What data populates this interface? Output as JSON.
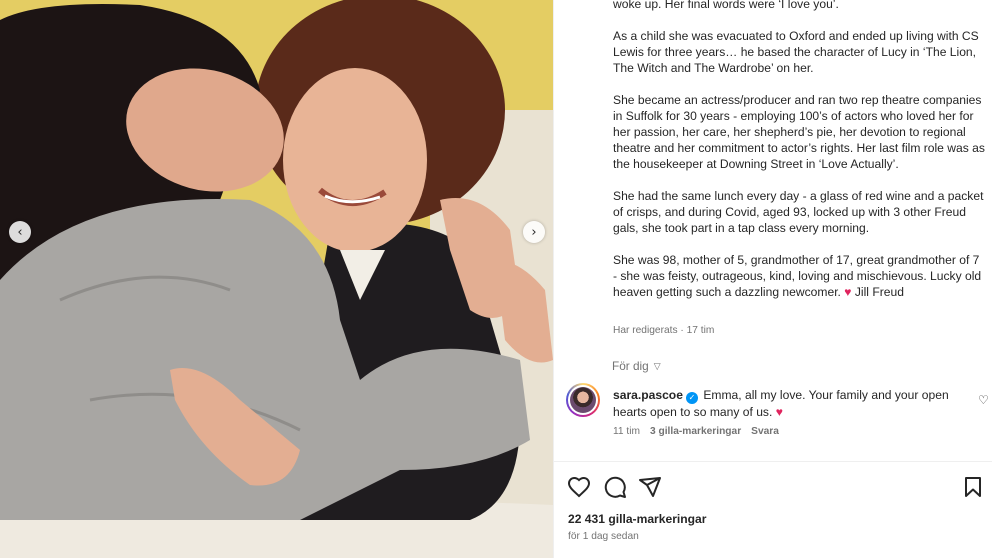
{
  "post": {
    "caption_paragraphs": [
      "woke up. Her final words were ‘I love you’.",
      "As a child she was evacuated to Oxford and ended up living with CS Lewis for three years… he based the character of Lucy in ‘The Lion, The Witch and The Wardrobe’ on her.",
      "She became an actress/producer and ran two rep theatre companies in Suffolk for 30 years - employing 100’s of actors who loved her for her passion, her care, her shepherd’s pie, her devotion to regional theatre and her commitment to actor’s rights. Her last film role was as the housekeeper at Downing Street in ‘Love Actually’.",
      "She had the same lunch every day - a glass of red wine and a packet of crisps, and during Covid, aged 93, locked up with 3 other Freud gals, she took part in a tap class every morning."
    ],
    "last_paragraph": "She was 98, mother of 5, grandmother of 17, great grandmother of 7 - she was feisty, outrageous, kind, loving and mischievous. Lucky old heaven getting such a dazzling newcomer.",
    "heart_glyph": "♥",
    "author_signoff": "Jill Freud",
    "edited_meta": "Har redigerats · 17 tim"
  },
  "for_you": {
    "label": "För dig"
  },
  "comment": {
    "username": "sara.pascoe",
    "text": "Emma, all my love. Your family and your open hearts open to so many of us.",
    "heart_glyph": "♥",
    "time": "11 tim",
    "likes": "3 gilla-markeringar",
    "reply": "Svara"
  },
  "actions": {
    "likes_count": "22 431 gilla-markeringar",
    "posted": "för 1 dag sedan"
  },
  "colors": {
    "accent_blue": "#0095f6",
    "heart_red": "#e0245e",
    "muted": "#737373"
  }
}
